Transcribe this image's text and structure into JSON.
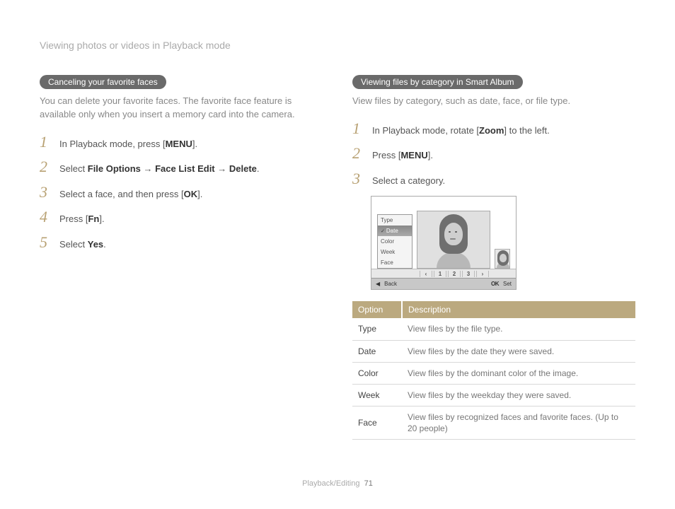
{
  "header": "Viewing photos or videos in Playback mode",
  "left": {
    "pill": "Canceling your favorite faces",
    "intro": "You can delete your favorite faces. The favorite face feature is available only when you insert a memory card into the camera.",
    "steps": [
      {
        "pre": "In Playback mode, press [",
        "bold": "MENU",
        "post": "]."
      },
      {
        "pre": "Select ",
        "bold": "File Options",
        "mid1": " → ",
        "bold2": "Face List Edit",
        "mid2": " → ",
        "bold3": "Delete",
        "post": "."
      },
      {
        "pre": "Select a face, and then press [",
        "bold": "OK",
        "post": "]."
      },
      {
        "pre": "Press [",
        "bold": "Fn",
        "post": "]."
      },
      {
        "pre": "Select ",
        "bold": "Yes",
        "post": "."
      }
    ]
  },
  "right": {
    "pill": "Viewing files by category in Smart Album",
    "intro": "View files by category, such as date, face, or file type.",
    "steps": [
      {
        "pre": "In Playback mode, rotate [",
        "bold": "Zoom",
        "post": "] to the left."
      },
      {
        "pre": "Press [",
        "bold": "MENU",
        "post": "]."
      },
      {
        "pre": "Select a category.",
        "bold": "",
        "post": ""
      }
    ],
    "screen": {
      "menu": [
        "Type",
        "Date",
        "Color",
        "Week",
        "Face"
      ],
      "selectedIndex": 1,
      "pages": [
        "1",
        "2",
        "3"
      ],
      "pager_left": "‹",
      "pager_right": "›",
      "bar_left_icon": "◀",
      "bar_back": "Back",
      "bar_ok": "OK",
      "bar_set": "Set"
    },
    "table": {
      "head": [
        "Option",
        "Description"
      ],
      "rows": [
        [
          "Type",
          "View files by the file type."
        ],
        [
          "Date",
          "View files by the date they were saved."
        ],
        [
          "Color",
          "View files by the dominant color of the image."
        ],
        [
          "Week",
          "View files by the weekday they were saved."
        ],
        [
          "Face",
          "View files by recognized faces and favorite faces. (Up to 20 people)"
        ]
      ]
    }
  },
  "footer": {
    "section": "Playback/Editing",
    "page": "71"
  }
}
